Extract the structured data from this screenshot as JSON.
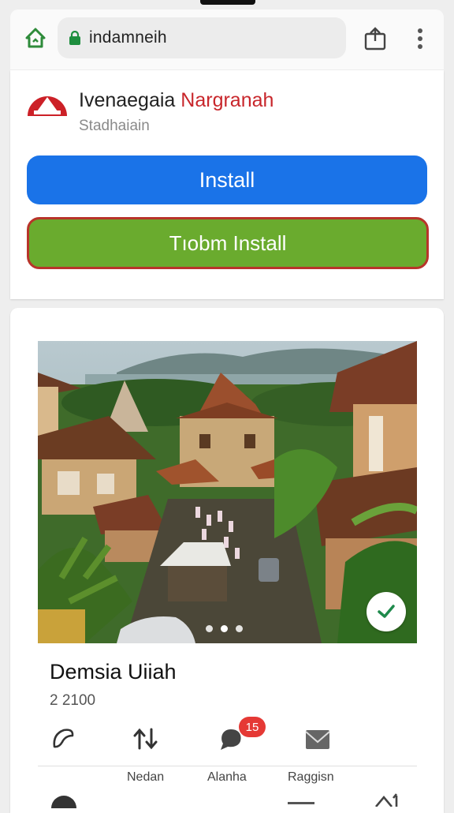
{
  "browser": {
    "url": "indamneih",
    "icons": [
      "home-icon",
      "lock-icon",
      "share-icon",
      "more-vert-icon"
    ]
  },
  "install_banner": {
    "app_name_part1": "Ivenaegaia",
    "app_name_part2": "Nargranah",
    "subtitle": "Stadhaiain",
    "install_label": "Install",
    "alt_install_label": "Tıobm Install"
  },
  "post": {
    "title": "Demsia Uiiah",
    "count": "2 2100",
    "notification_count": "15",
    "actions": [
      "like-icon",
      "share-icon",
      "comment-icon",
      "message-icon"
    ],
    "tabs": [
      "Nedan",
      "Alanha",
      "Raggisn"
    ]
  },
  "colors": {
    "install_blue": "#1a73e8",
    "alt_green": "#6aab2e",
    "alt_border": "#b8342a",
    "accent_red": "#c8262b",
    "home_green": "#2e8b3a"
  }
}
